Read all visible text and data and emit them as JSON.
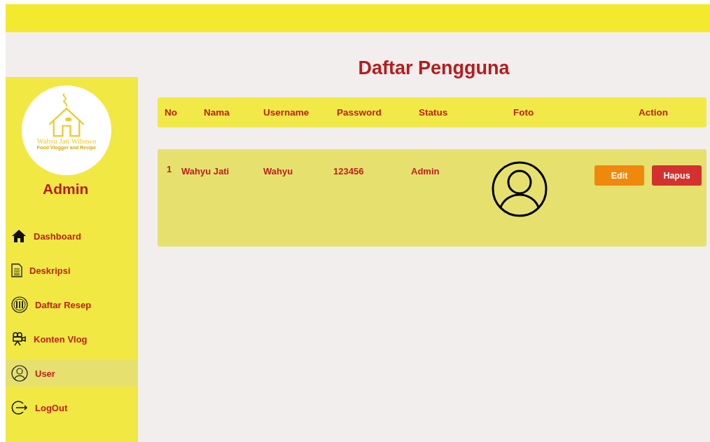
{
  "sidebar": {
    "logo": {
      "name": "Wahyu Jati Wibowo",
      "tagline": "Food Vlogger and Recipe"
    },
    "role": "Admin",
    "items": [
      {
        "label": "Dashboard",
        "kind": "home",
        "selected": false
      },
      {
        "label": "Deskripsi",
        "kind": "document",
        "selected": false
      },
      {
        "label": "Daftar Resep",
        "kind": "plate",
        "selected": false
      },
      {
        "label": "Konten Vlog",
        "kind": "camera",
        "selected": false
      },
      {
        "label": "User",
        "kind": "user",
        "selected": true
      },
      {
        "label": "LogOut",
        "kind": "logout",
        "selected": false
      }
    ]
  },
  "page_title": "Daftar Pengguna",
  "table": {
    "columns": [
      "No",
      "Nama",
      "Username",
      "Password",
      "Status",
      "Foto",
      "Action"
    ],
    "rows": [
      {
        "no": "1",
        "nama": "Wahyu Jati",
        "username": "Wahyu",
        "password": "123456",
        "status": "Admin",
        "actions": [
          "Edit",
          "Hapus"
        ]
      }
    ]
  }
}
